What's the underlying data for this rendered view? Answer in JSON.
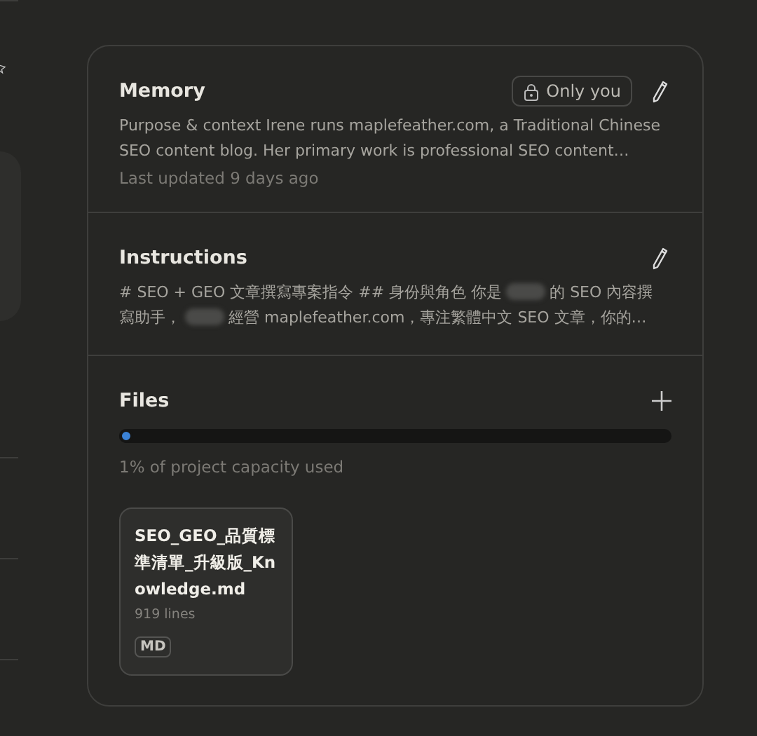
{
  "memory": {
    "title": "Memory",
    "visibility": "Only you",
    "lines": [
      "Purpose & context Irene runs maplefeather.com, a Traditional Chinese",
      "SEO content blog. Her primary work is professional SEO content…"
    ],
    "updated": "Last updated 9 days ago"
  },
  "instructions": {
    "title": "Instructions",
    "lines": [
      [
        {
          "kind": "text",
          "text": "# SEO + GEO 文章撰寫專案指令 ## 身份與角色 你是"
        },
        {
          "kind": "redacted"
        },
        {
          "kind": "text",
          "text": "的 SEO 內容撰"
        }
      ],
      [
        {
          "kind": "text",
          "text": "寫助手，"
        },
        {
          "kind": "redacted"
        },
        {
          "kind": "text",
          "text": "經營 maplefeather.com，專注繁體中文 SEO 文章，你的…"
        }
      ]
    ]
  },
  "files": {
    "title": "Files",
    "capacity": {
      "level": 0.01,
      "text": "1% of project capacity used"
    },
    "items": [
      {
        "name": "SEO_GEO_品質標準清單_升級版_Knowledge.md",
        "lines": "919 lines",
        "type": "MD"
      }
    ]
  }
}
